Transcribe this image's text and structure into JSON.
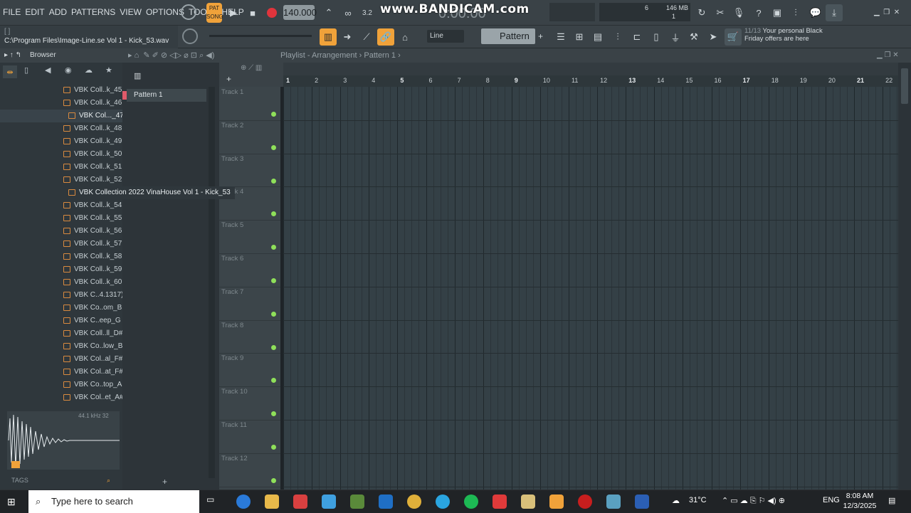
{
  "menu": [
    "FILE",
    "EDIT",
    "ADD",
    "PATTERNS",
    "VIEW",
    "OPTIONS",
    "TOOLS",
    "HELP"
  ],
  "transport": {
    "mode_label": "PAT",
    "mode_sub": "SONG",
    "bpm": "140.000",
    "time": "0:00:00",
    "pattern_label": "Pattern 1",
    "snap": "Line"
  },
  "watermark": "www.BANDICAM.com",
  "cpu": {
    "value": "6",
    "memory": "146 MB",
    "poly": "1"
  },
  "hint": {
    "line1": "[ ]",
    "line2": "C:\\Program Files\\Image-Line.se Vol 1 -  Kick_53.wav"
  },
  "promo": {
    "count": "11/13",
    "text": "Your personal Black Friday offers are here"
  },
  "browser": {
    "title": "Browser",
    "files": [
      "VBK Coll..k_45",
      "VBK Coll..k_46",
      "VBK Col..._47",
      "VBK Coll..k_48",
      "VBK Coll..k_49",
      "VBK Coll..k_50",
      "VBK Coll..k_51",
      "VBK Coll..k_52",
      "VBK Collection 2022 VinaHouse Vol 1 -  Kick_53",
      "VBK Coll..k_54",
      "VBK Coll..k_55",
      "VBK Coll..k_56",
      "VBK Coll..k_57",
      "VBK Coll..k_58",
      "VBK Coll..k_59",
      "VBK Coll..k_60",
      "VBK C..4.1317)",
      "VBK Co..om_B",
      "VBK C..eep_G",
      "VBK Coll..ll_D#",
      "VBK Co..low_B",
      "VBK Col..al_F#",
      "VBK Col..at_F#",
      "VBK Co..top_A",
      "VBK Col..et_A#"
    ],
    "wave_info": "44.1 kHz 32",
    "tags_label": "TAGS"
  },
  "playlist": {
    "breadcrumb": "Playlist - Arrangement  ›  Pattern 1  ›",
    "pattern_item": "Pattern 1",
    "tracks": [
      "Track 1",
      "Track 2",
      "Track 3",
      "Track 4",
      "Track 5",
      "Track 6",
      "Track 7",
      "Track 8",
      "Track 9",
      "Track 10",
      "Track 11",
      "Track 12"
    ],
    "bars": [
      "1",
      "2",
      "3",
      "4",
      "5",
      "6",
      "7",
      "8",
      "9",
      "10",
      "11",
      "12",
      "13",
      "14",
      "15",
      "16",
      "17",
      "18",
      "19",
      "20",
      "21",
      "22"
    ]
  },
  "taskbar": {
    "search_placeholder": "Type here to search",
    "weather": "31°C",
    "lang": "ENG",
    "time": "8:08 AM",
    "date": "12/3/2025"
  }
}
